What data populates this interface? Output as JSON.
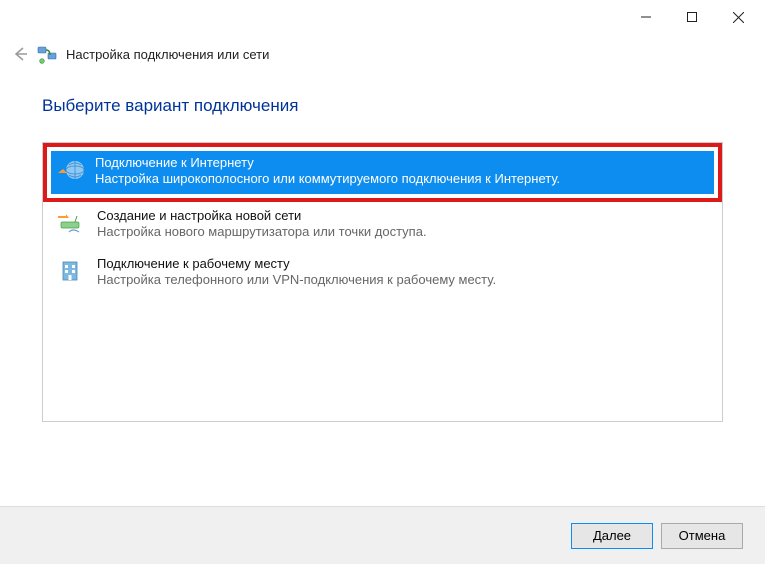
{
  "window": {
    "title": "Настройка подключения или сети"
  },
  "heading": "Выберите вариант подключения",
  "options": [
    {
      "title": "Подключение к Интернету",
      "desc": "Настройка широкополосного или коммутируемого подключения к Интернету."
    },
    {
      "title": "Создание и настройка новой сети",
      "desc": "Настройка нового маршрутизатора или точки доступа."
    },
    {
      "title": "Подключение к рабочему месту",
      "desc": "Настройка телефонного или VPN-подключения к рабочему месту."
    }
  ],
  "buttons": {
    "next": "Далее",
    "cancel": "Отмена"
  }
}
